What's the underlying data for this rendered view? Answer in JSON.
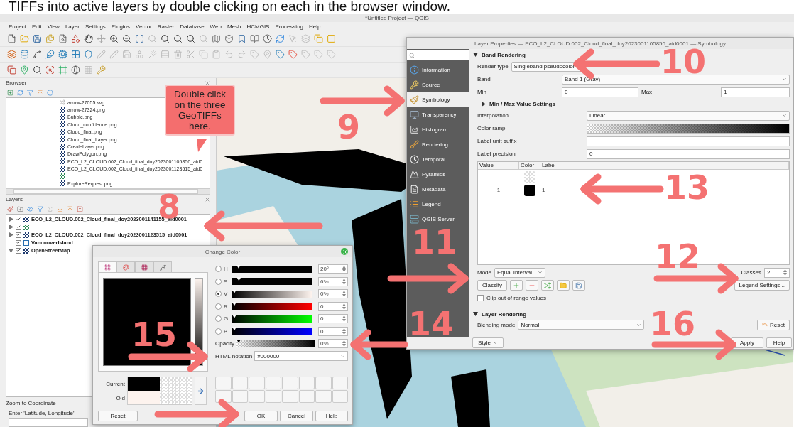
{
  "caption": "TIFFs into active layers by double clicking on each in the browser window.",
  "window": {
    "title": "*Untitled Project — QGIS"
  },
  "menu": [
    "Project",
    "Edit",
    "View",
    "Layer",
    "Settings",
    "Plugins",
    "Vector",
    "Raster",
    "Database",
    "Web",
    "Mesh",
    "HCMGIS",
    "Processing",
    "Help"
  ],
  "browser": {
    "title": "Browser",
    "items": [
      {
        "name": "arrow-27055.svg",
        "kind": "svg"
      },
      {
        "name": "arrow-27324.png",
        "kind": "raster"
      },
      {
        "name": "Bubble.png",
        "kind": "raster"
      },
      {
        "name": "Cloud_confidence.png",
        "kind": "raster"
      },
      {
        "name": "Cloud_final.png",
        "kind": "raster"
      },
      {
        "name": "Cloud_final_Layer.png",
        "kind": "raster"
      },
      {
        "name": "CreateLayer.png",
        "kind": "raster"
      },
      {
        "name": "DrawPolygon.png",
        "kind": "raster"
      },
      {
        "name": "ECO_L2_CLOUD.002_Cloud_final_doy2023001105856_aid0",
        "kind": "raster"
      },
      {
        "name": "ECO_L2_CLOUD.002_Cloud_final_doy2023001123515_aid0",
        "kind": "raster"
      },
      {
        "kind": "grid"
      },
      {
        "name": "ExploreRequest.png",
        "kind": "raster"
      }
    ]
  },
  "layers": {
    "title": "Layers",
    "items": [
      {
        "name": "ECO_L2_CLOUD.002_Cloud_final_doy2023001141155_aid0001",
        "kind": "raster",
        "checked": true,
        "expanded": false
      },
      {
        "kind": "grid",
        "checked": true,
        "expanded": false
      },
      {
        "name": "ECO_L2_CLOUD.002_Cloud_final_doy2023001123515_aid0001",
        "kind": "raster",
        "checked": true,
        "expanded": false
      },
      {
        "name": "VancouverIsland",
        "kind": "polygon",
        "checked": true
      },
      {
        "name": "OpenStreetMap",
        "kind": "raster",
        "checked": true,
        "expanded": true
      }
    ]
  },
  "zoom_to_coordinate": {
    "title": "Zoom to Coordinate",
    "label": "Enter 'Latitude, Longitude'"
  },
  "callout": {
    "text": "Double click on the three GeoTIFFs here."
  },
  "layer_properties": {
    "title": "Layer Properties — ECO_L2_CLOUD.002_Cloud_final_doy2023001105856_aid0001 — Symbology",
    "nav": [
      {
        "label": "Information",
        "selected": false
      },
      {
        "label": "Source",
        "selected": false
      },
      {
        "label": "Symbology",
        "selected": true
      },
      {
        "label": "Transparency",
        "selected": false
      },
      {
        "label": "Histogram",
        "selected": false
      },
      {
        "label": "Rendering",
        "selected": false
      },
      {
        "label": "Temporal",
        "selected": false
      },
      {
        "label": "Pyramids",
        "selected": false
      },
      {
        "label": "Metadata",
        "selected": false
      },
      {
        "label": "Legend",
        "selected": false
      },
      {
        "label": "QGIS Server",
        "selected": false
      }
    ],
    "band_rendering": {
      "title": "Band Rendering",
      "expanded": true
    },
    "render_type": {
      "label": "Render type",
      "value": "Singleband pseudocolor"
    },
    "band": {
      "label": "Band",
      "value": "Band 1 (Gray)"
    },
    "min": {
      "label": "Min",
      "value": "0"
    },
    "max": {
      "label": "Max",
      "value": "1"
    },
    "minmax_settings": {
      "label": "Min / Max Value Settings",
      "expanded": false
    },
    "interpolation": {
      "label": "Interpolation",
      "value": "Linear"
    },
    "color_ramp": {
      "label": "Color ramp"
    },
    "label_unit_suffix": {
      "label": "Label unit suffix"
    },
    "label_precision": {
      "label": "Label precision",
      "value": "0"
    },
    "table": {
      "columns": [
        "Value",
        "Color",
        "Label"
      ],
      "rows": [
        {
          "transparent": true
        },
        {
          "value": "1",
          "color": "#000000",
          "label": "1",
          "transparent": false
        }
      ]
    },
    "mode": {
      "label": "Mode",
      "value": "Equal Interval"
    },
    "classes": {
      "label": "Classes",
      "value": "2"
    },
    "classify": "Classify",
    "legend_settings": "Legend Settings...",
    "clip": {
      "label": "Clip out of range values",
      "checked": false
    },
    "layer_rendering": {
      "title": "Layer Rendering",
      "expanded": true
    },
    "blending": {
      "label": "Blending mode",
      "value": "Normal"
    },
    "reset": "Reset",
    "style": "Style",
    "apply": "Apply",
    "help": "Help"
  },
  "change_color": {
    "title": "Change Color",
    "tabs": [
      {
        "selected": true
      },
      {
        "selected": false
      },
      {
        "selected": false
      },
      {
        "selected": false
      }
    ],
    "channels": [
      {
        "label": "H",
        "value": "20°",
        "level": 0.056,
        "selected": false
      },
      {
        "label": "S",
        "value": "6%",
        "level": 0.06,
        "selected": false
      },
      {
        "label": "V",
        "value": "0%",
        "level": 0,
        "selected": true
      },
      {
        "label": "R",
        "value": "0",
        "level": 0,
        "selected": false
      },
      {
        "label": "G",
        "value": "0",
        "level": 0,
        "selected": false
      },
      {
        "label": "B",
        "value": "0",
        "level": 0,
        "selected": false
      }
    ],
    "opacity": {
      "label": "Opacity",
      "value": "0%",
      "level": 0
    },
    "html": {
      "label": "HTML notation",
      "value": "#000000"
    },
    "current": {
      "label": "Current",
      "color": "#000000"
    },
    "old": {
      "label": "Old",
      "color": "#fdf3ee"
    },
    "reset": "Reset",
    "ok": "OK",
    "cancel": "Cancel",
    "help": "Help"
  },
  "annotations": [
    "10",
    "9",
    "13",
    "8",
    "11",
    "12",
    "14",
    "16",
    "15"
  ]
}
